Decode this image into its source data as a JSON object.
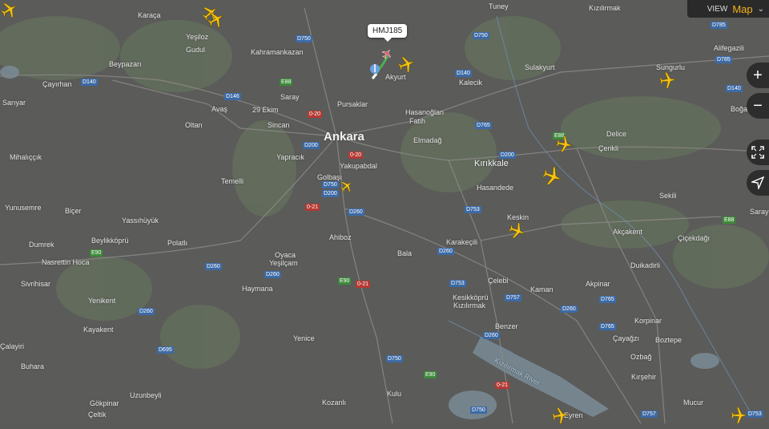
{
  "map": {
    "places": [
      {
        "id": "karacaoren",
        "text": "Karaça"
      },
      {
        "id": "yesiloz",
        "text": "Yeşiloz"
      },
      {
        "id": "gudul",
        "text": "Gudul"
      },
      {
        "id": "beypazari",
        "text": "Beypazarı"
      },
      {
        "id": "cayirhan",
        "text": "Çayırhan"
      },
      {
        "id": "sariyar",
        "text": "Sarıyar"
      },
      {
        "id": "kahramankazan",
        "text": "Kahramankazan"
      },
      {
        "id": "saray",
        "text": "Saray"
      },
      {
        "id": "ayas",
        "text": "Avaş"
      },
      {
        "id": "ekim",
        "text": "29 Ekim"
      },
      {
        "id": "sincan",
        "text": "Sincan"
      },
      {
        "id": "oltan",
        "text": "Oltan"
      },
      {
        "id": "pursaklar",
        "text": "Pursaklar"
      },
      {
        "id": "ankara",
        "text": "Ankara"
      },
      {
        "id": "yapracik",
        "text": "Yapracık"
      },
      {
        "id": "yakupabdal",
        "text": "Yakupabdal"
      },
      {
        "id": "golbasi",
        "text": "Golbaşı"
      },
      {
        "id": "temelli",
        "text": "Temelli"
      },
      {
        "id": "mihaliccik",
        "text": "Mihalıççık"
      },
      {
        "id": "yunusemre",
        "text": "Yunusemre"
      },
      {
        "id": "bicer",
        "text": "Biçer"
      },
      {
        "id": "yassihuyuk",
        "text": "Yassıhüyük"
      },
      {
        "id": "beylikkoprusu",
        "text": "Beylikköprü"
      },
      {
        "id": "polatli",
        "text": "Polatlı"
      },
      {
        "id": "dumrek",
        "text": "Dumrek"
      },
      {
        "id": "nasrettin",
        "text": "Nasrettin Hoca"
      },
      {
        "id": "sivrihisar",
        "text": "Sivrihisar"
      },
      {
        "id": "oyaca",
        "text": "Oyaca"
      },
      {
        "id": "yesilcam",
        "text": "Yeşilçam"
      },
      {
        "id": "haymana",
        "text": "Haymana"
      },
      {
        "id": "yenikent",
        "text": "Yenikent"
      },
      {
        "id": "kayakent",
        "text": "Kayakent"
      },
      {
        "id": "calayiri",
        "text": "Çalayiri"
      },
      {
        "id": "buhara",
        "text": "Buhara"
      },
      {
        "id": "yenice",
        "text": "Yenice"
      },
      {
        "id": "uzunbeyli",
        "text": "Uzunbeyli"
      },
      {
        "id": "gokpinar",
        "text": "Gökpinar"
      },
      {
        "id": "celtik",
        "text": "Çeltik"
      },
      {
        "id": "kozanli",
        "text": "Kozanlı"
      },
      {
        "id": "kulu",
        "text": "Kulu"
      },
      {
        "id": "ahiboz",
        "text": "Ahiboz"
      },
      {
        "id": "bala",
        "text": "Bala"
      },
      {
        "id": "akyurt",
        "text": "Akyurt"
      },
      {
        "id": "hasanoglan",
        "text": "Hasanoğlan"
      },
      {
        "id": "fatih",
        "text": "Fatih"
      },
      {
        "id": "elmadag",
        "text": "Elmadağ"
      },
      {
        "id": "kalecik",
        "text": "Kalecik"
      },
      {
        "id": "sulakyurt",
        "text": "Sulakyurt"
      },
      {
        "id": "tuney",
        "text": "Tuney"
      },
      {
        "id": "kizilirmak",
        "text": "Kızılirmak"
      },
      {
        "id": "kirikkale",
        "text": "Kırıkkale"
      },
      {
        "id": "hasandede",
        "text": "Hasandede"
      },
      {
        "id": "keskin",
        "text": "Keskin"
      },
      {
        "id": "karakecili",
        "text": "Karakeçili"
      },
      {
        "id": "celebi",
        "text": "Çelebi"
      },
      {
        "id": "kesikkopru",
        "text": "Kesikköprü"
      },
      {
        "id": "kizilirmak2",
        "text": "Kızılırmak"
      },
      {
        "id": "kaman",
        "text": "Kaman"
      },
      {
        "id": "benzer",
        "text": "Benzer"
      },
      {
        "id": "akpinar",
        "text": "Akpinar"
      },
      {
        "id": "duikadirli",
        "text": "Duikadirli"
      },
      {
        "id": "akcakent",
        "text": "Akçakent"
      },
      {
        "id": "cicekdagi",
        "text": "Çiçekdağı"
      },
      {
        "id": "sekili",
        "text": "Sekili"
      },
      {
        "id": "delice",
        "text": "Delice"
      },
      {
        "id": "cerikli",
        "text": "Çerikli"
      },
      {
        "id": "sungurlu",
        "text": "Sungurlu"
      },
      {
        "id": "alifegazili",
        "text": "Alifegazili"
      },
      {
        "id": "boga",
        "text": "Boğa"
      },
      {
        "id": "saray2",
        "text": "Saray"
      },
      {
        "id": "korpinar",
        "text": "Korpinar"
      },
      {
        "id": "boztepe",
        "text": "Boztepe"
      },
      {
        "id": "cayagzi",
        "text": "Çayağzı"
      },
      {
        "id": "ozbag",
        "text": "Ozbağ"
      },
      {
        "id": "kirsehir",
        "text": "Kırşehir"
      },
      {
        "id": "mucur",
        "text": "Mucur"
      },
      {
        "id": "eyren",
        "text": "Eyren"
      },
      {
        "id": "kizilirmakriver",
        "text": "Kızılırmak River"
      }
    ],
    "road_shields": [
      "D750",
      "D140",
      "D146",
      "E88",
      "D200",
      "0-20",
      "D200",
      "0-20",
      "D750",
      "0-21",
      "D260",
      "E90",
      "0-21",
      "D260",
      "D260",
      "E90",
      "D260",
      "D695",
      "D260",
      "D200",
      "D750",
      "D765",
      "D753",
      "D753",
      "D260",
      "D757",
      "D260",
      "D765",
      "D757",
      "D750",
      "E90",
      "0-21",
      "D750",
      "D753",
      "E88",
      "E88",
      "D785",
      "D140",
      "D785",
      "D765",
      "D140"
    ],
    "flight_callout": "HMJ185"
  },
  "view_bar": {
    "view_label": "VIEW",
    "map_type": "Map",
    "chevron_icon": "chevron-down-icon"
  },
  "controls": {
    "zoom_in": "+",
    "zoom_out": "−",
    "fullscreen_icon": "fullscreen-icon",
    "locate_icon": "locate-arrow-icon"
  },
  "colors": {
    "plane": "#f6c414",
    "selected_plane": "#e63946",
    "accent": "#f6b21a",
    "trail": "#4caf50"
  }
}
